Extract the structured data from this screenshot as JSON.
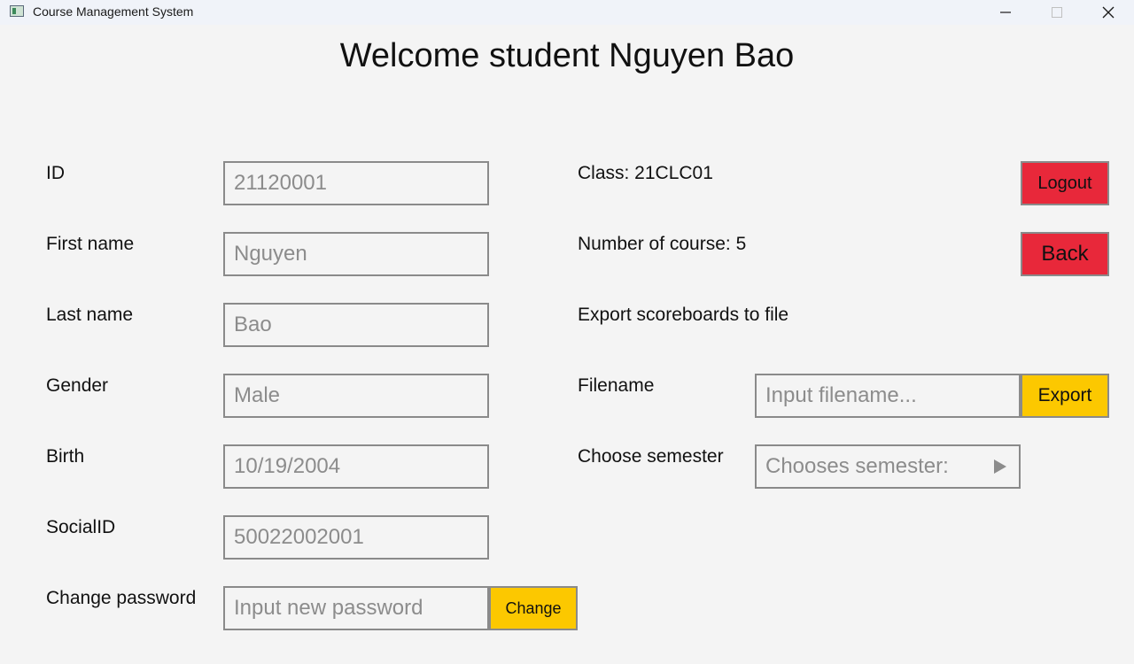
{
  "window": {
    "title": "Course Management System"
  },
  "heading": "Welcome student Nguyen Bao",
  "profile": {
    "id": {
      "label": "ID",
      "value": "21120001"
    },
    "first_name": {
      "label": "First name",
      "value": "Nguyen"
    },
    "last_name": {
      "label": "Last name",
      "value": "Bao"
    },
    "gender": {
      "label": "Gender",
      "value": "Male"
    },
    "birth": {
      "label": "Birth",
      "value": "10/19/2004"
    },
    "social_id": {
      "label": "SocialID",
      "value": "50022002001"
    },
    "change_password": {
      "label": "Change password",
      "placeholder": "Input new password",
      "button": "Change"
    }
  },
  "info": {
    "class_text": "Class: 21CLC01",
    "course_count_text": "Number of course: 5",
    "export_heading": "Export scoreboards to file",
    "filename": {
      "label": "Filename",
      "placeholder": "Input filename...",
      "button": "Export"
    },
    "semester": {
      "label": "Choose semester",
      "value": "Chooses semester:"
    }
  },
  "actions": {
    "logout": "Logout",
    "back": "Back"
  },
  "colors": {
    "danger": "#e8283a",
    "warning": "#fcc800",
    "background": "#f4f4f4"
  },
  "icons": {
    "minimize": "minimize-icon",
    "maximize": "maximize-icon",
    "close": "close-icon",
    "dropdown": "play-arrow-icon"
  }
}
